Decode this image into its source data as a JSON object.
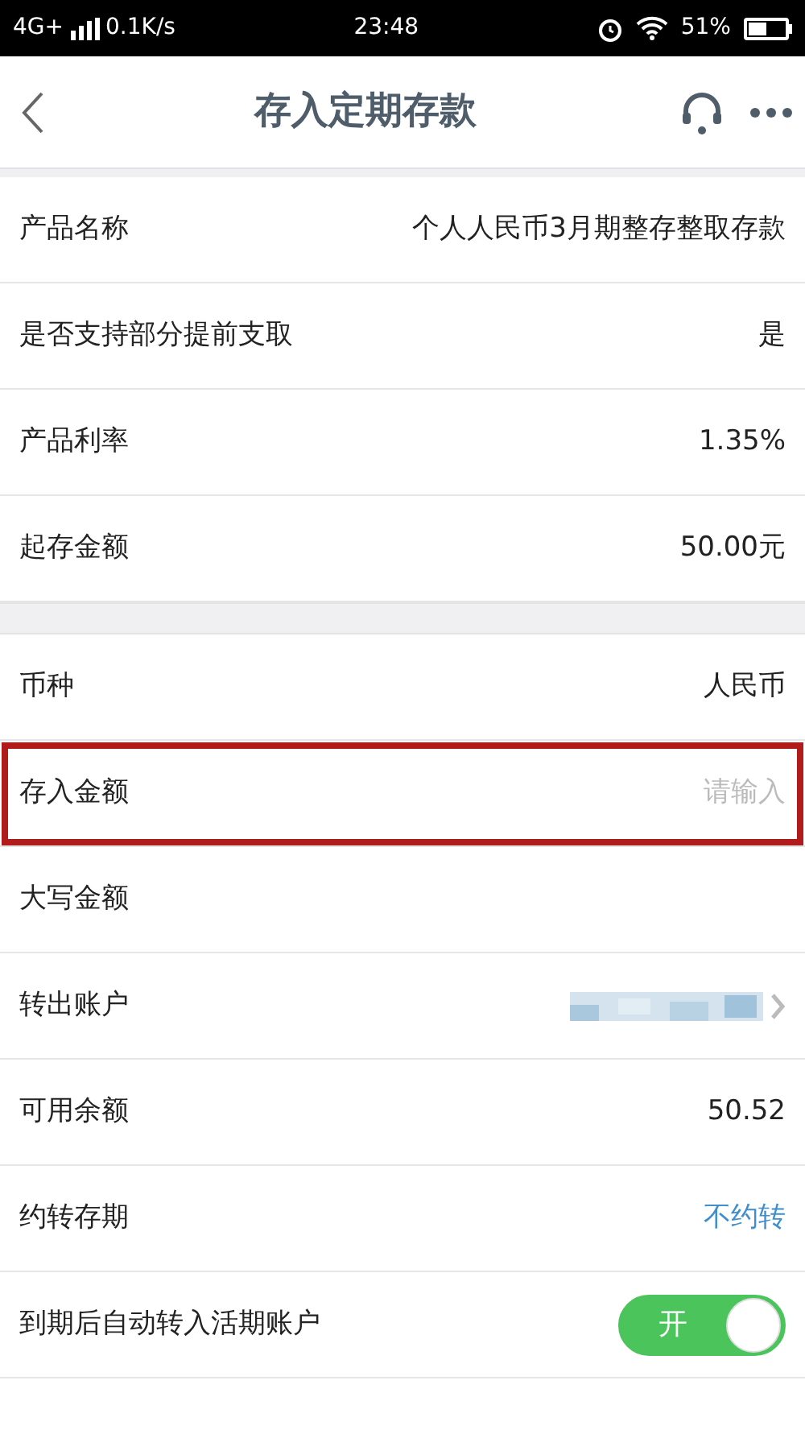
{
  "status_bar": {
    "network": "4G+",
    "speed": "0.1K/s",
    "time": "23:48",
    "battery": "51%"
  },
  "header": {
    "title": "存入定期存款"
  },
  "sections": [
    {
      "rows": [
        {
          "kind": "text",
          "label": "产品名称",
          "value": "个人人民币3月期整存整取存款",
          "highlighted": false
        },
        {
          "kind": "text",
          "label": "是否支持部分提前支取",
          "value": "是",
          "highlighted": false
        },
        {
          "kind": "text",
          "label": "产品利率",
          "value": "1.35%",
          "highlighted": false
        },
        {
          "kind": "text",
          "label": "起存金额",
          "value": "50.00元",
          "highlighted": false
        }
      ]
    },
    {
      "rows": [
        {
          "kind": "text",
          "label": "币种",
          "value": "人民币",
          "highlighted": false
        },
        {
          "kind": "input",
          "label": "存入金额",
          "placeholder": "请输入",
          "highlighted": true
        },
        {
          "kind": "text",
          "label": "大写金额",
          "highlighted": false
        },
        {
          "kind": "account",
          "label": "转出账户",
          "highlighted": false
        },
        {
          "kind": "text",
          "label": "可用余额",
          "value": "50.52",
          "highlighted": false
        },
        {
          "kind": "link",
          "label": "约转存期",
          "value": "不约转",
          "highlighted": false
        },
        {
          "kind": "toggle",
          "label": "到期后自动转入活期账户",
          "on": true,
          "toggle_text": "开",
          "highlighted": false
        }
      ]
    }
  ]
}
